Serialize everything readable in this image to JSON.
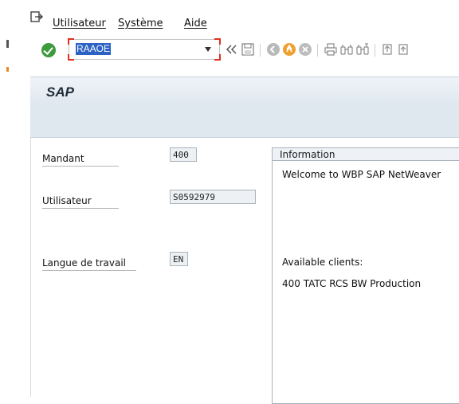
{
  "menu": {
    "items": [
      {
        "label": "Utilisateur"
      },
      {
        "label": "Système"
      },
      {
        "label": "Aide"
      }
    ]
  },
  "toolbar": {
    "command_field_value": "RAAOE"
  },
  "header": {
    "title": "SAP"
  },
  "form": {
    "client_label": "Mandant",
    "client_value": "400",
    "user_label": "Utilisateur",
    "user_value": "S0592979",
    "language_label": "Langue de travail",
    "language_value": "EN"
  },
  "info": {
    "title": "Information",
    "welcome": "Welcome to WBP SAP NetWeaver",
    "clients_heading": "Available clients:",
    "client_line": "400 TATC RCS BW Production"
  },
  "colors": {
    "accent_red": "#e0301e",
    "ok_green": "#3d9a3d",
    "header_bg": "#dde6ee",
    "selection_blue": "#2b62c4"
  }
}
